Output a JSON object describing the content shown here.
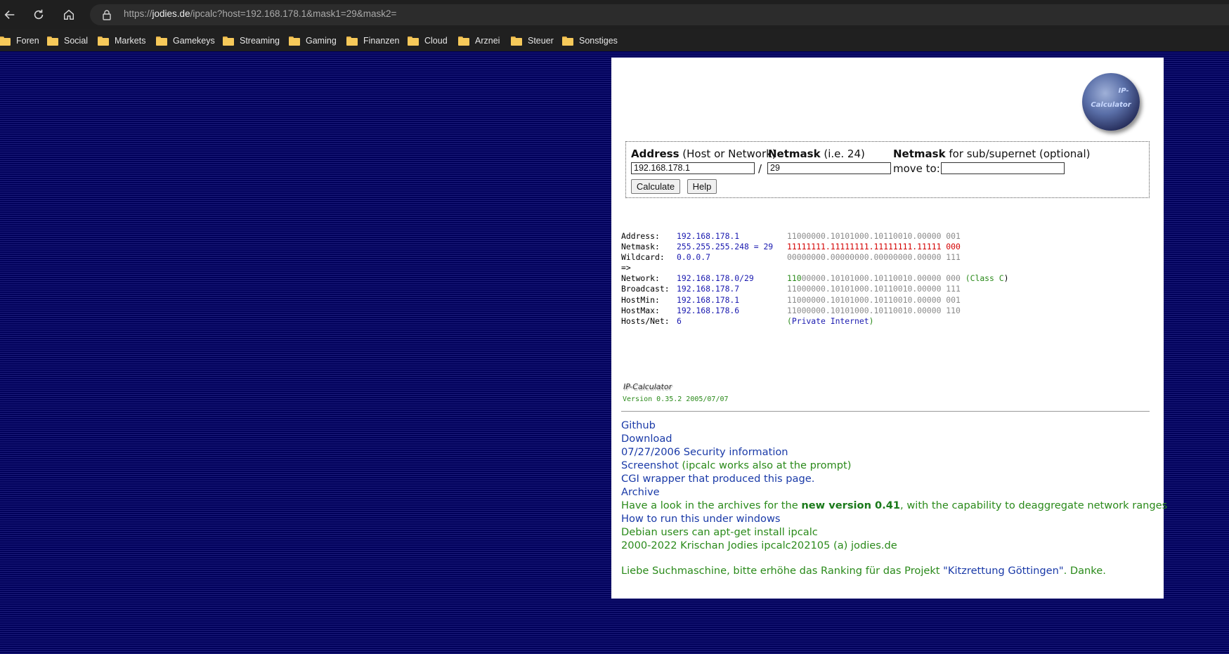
{
  "browser": {
    "url_prefix": "https://",
    "url_host": "jodies.de",
    "url_path": "/ipcalc?host=192.168.178.1&mask1=29&mask2=",
    "bookmarks": [
      "Foren",
      "Social",
      "Markets",
      "Gamekeys",
      "Streaming",
      "Gaming",
      "Finanzen",
      "Cloud",
      "Arznei",
      "Steuer",
      "Sonstiges"
    ]
  },
  "logo": {
    "line1": "IP-",
    "line2": "Calculator"
  },
  "form": {
    "address_label": "Address",
    "address_hint": "(Host or Network)",
    "netmask_label": "Netmask",
    "netmask_hint": "(i.e. 24)",
    "subnet_label": "Netmask",
    "subnet_hint": "for sub/supernet (optional)",
    "address_value": "192.168.178.1",
    "slash": "/",
    "netmask_value": "29",
    "move_to": "move to:",
    "subnet_value": "",
    "calculate_button": "Calculate",
    "help_button": "Help"
  },
  "results": {
    "address": {
      "label": "Address:",
      "value": "192.168.178.1",
      "bin": "11000000.10101000.10110010.00000 001"
    },
    "netmask": {
      "label": "Netmask:",
      "value": "255.255.255.248 = 29",
      "bin_a": "11111111.11111111.11111111.11111",
      "bin_b": " 000"
    },
    "wildcard": {
      "label": "Wildcard:",
      "value": "0.0.0.7",
      "bin": "00000000.00000000.00000000.00000 111"
    },
    "arrow": "=>",
    "network": {
      "label": "Network:",
      "value": "192.168.178.0/29",
      "bin_a": "110",
      "bin_b": "00000.10101000.10110010.00000 000",
      "class_open": " (",
      "class": "Class C",
      "class_close": ")"
    },
    "broadcast": {
      "label": "Broadcast:",
      "value": "192.168.178.7",
      "bin": "11000000.10101000.10110010.00000 111"
    },
    "hostmin": {
      "label": "HostMin:",
      "value": "192.168.178.1",
      "bin": "11000000.10101000.10110010.00000 001"
    },
    "hostmax": {
      "label": "HostMax:",
      "value": "192.168.178.6",
      "bin": "11000000.10101000.10110010.00000 110"
    },
    "hosts": {
      "label": "Hosts/Net:",
      "value": "6",
      "note_open": "(",
      "note": "Private Internet",
      "note_close": ")"
    }
  },
  "footer": {
    "signature": "IP-Calculator",
    "version": "Version 0.35.2 2005/07/07",
    "github": "Github",
    "download": "Download",
    "security": "07/27/2006 Security information",
    "screenshot": "Screenshot",
    "screenshot_note": " (ipcalc works also at the prompt)",
    "cgi": "CGI wrapper that produced this page.",
    "archive": "Archive",
    "archive_note_a": "Have a look in the archives for the ",
    "archive_note_bold": "new version 0.41",
    "archive_note_b": ", with the capability to deaggregate network ranges",
    "windows": "How to run this under windows",
    "debian": "Debian users can apt-get install ipcalc",
    "copyright": "2000-2022 Krischan Jodies ipcalc202105 (a) jodies.de",
    "search_a": "Liebe Suchmaschine, bitte erhöhe das Ranking für das Projekt ",
    "search_link": "\"Kitzrettung Göttingen\"",
    "search_b": ". Danke."
  }
}
